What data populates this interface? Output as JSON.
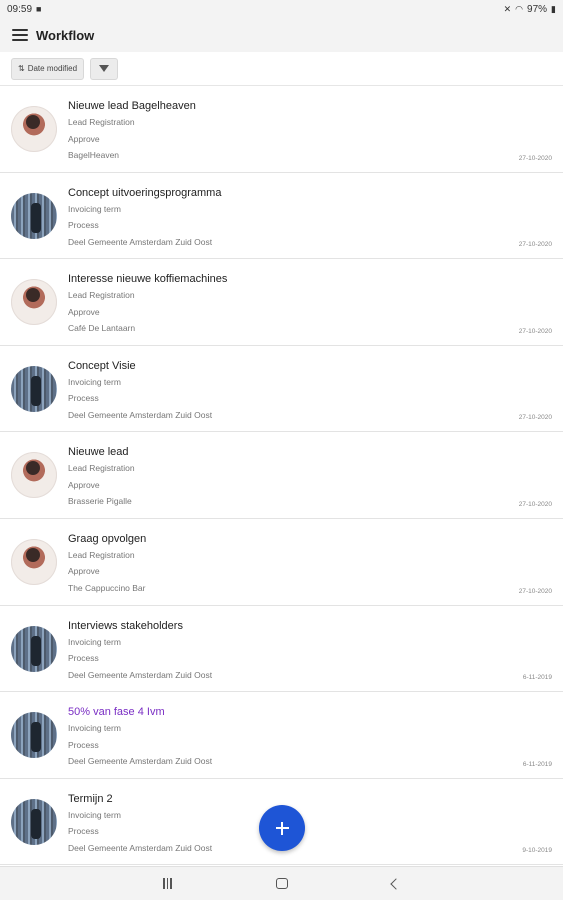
{
  "status_bar": {
    "time": "09:59",
    "battery": "97%",
    "icons": [
      "notification-icon",
      "mute-icon",
      "wifi-icon",
      "battery-icon"
    ]
  },
  "app_bar": {
    "title": "Workflow",
    "menu_icon": "hamburger-menu-icon"
  },
  "filter_bar": {
    "sort_label": "Date modified",
    "sort_icon": "sort-arrows-icon",
    "filter_icon": "filter-funnel-icon"
  },
  "items": [
    {
      "title": "Nieuwe lead Bagelheaven",
      "type": "Lead Registration",
      "status": "Approve",
      "company": "BagelHeaven",
      "date": "27-10-2020",
      "avatar": "woman",
      "highlight": false
    },
    {
      "title": "Concept uitvoeringsprogramma",
      "type": "Invoicing term",
      "status": "Process",
      "company": "Deel Gemeente Amsterdam Zuid Oost",
      "date": "27-10-2020",
      "avatar": "man",
      "highlight": false
    },
    {
      "title": "Interesse nieuwe koffiemachines",
      "type": "Lead Registration",
      "status": "Approve",
      "company": "Café De Lantaarn",
      "date": "27-10-2020",
      "avatar": "woman",
      "highlight": false
    },
    {
      "title": "Concept Visie",
      "type": "Invoicing term",
      "status": "Process",
      "company": "Deel Gemeente Amsterdam Zuid Oost",
      "date": "27-10-2020",
      "avatar": "man",
      "highlight": false
    },
    {
      "title": "Nieuwe lead",
      "type": "Lead Registration",
      "status": "Approve",
      "company": "Brasserie Pigalle",
      "date": "27-10-2020",
      "avatar": "woman",
      "highlight": false
    },
    {
      "title": "Graag opvolgen",
      "type": "Lead Registration",
      "status": "Approve",
      "company": "The Cappuccino Bar",
      "date": "27-10-2020",
      "avatar": "woman",
      "highlight": false
    },
    {
      "title": "Interviews stakeholders",
      "type": "Invoicing term",
      "status": "Process",
      "company": "Deel Gemeente Amsterdam Zuid Oost",
      "date": "6-11-2019",
      "avatar": "man",
      "highlight": false
    },
    {
      "title": "50% van fase 4 Ivm",
      "type": "Invoicing term",
      "status": "Process",
      "company": "Deel Gemeente Amsterdam Zuid Oost",
      "date": "6-11-2019",
      "avatar": "man",
      "highlight": true
    },
    {
      "title": "Termijn 2",
      "type": "Invoicing term",
      "status": "Process",
      "company": "Deel Gemeente Amsterdam Zuid Oost",
      "date": "9-10-2019",
      "avatar": "man",
      "highlight": false
    }
  ],
  "fab": {
    "icon": "plus-icon"
  },
  "nav_bar": {
    "icons": [
      "recents-icon",
      "home-icon",
      "back-icon"
    ]
  },
  "colors": {
    "accent": "#1e55d6",
    "highlight_title": "#7a2ec4"
  }
}
